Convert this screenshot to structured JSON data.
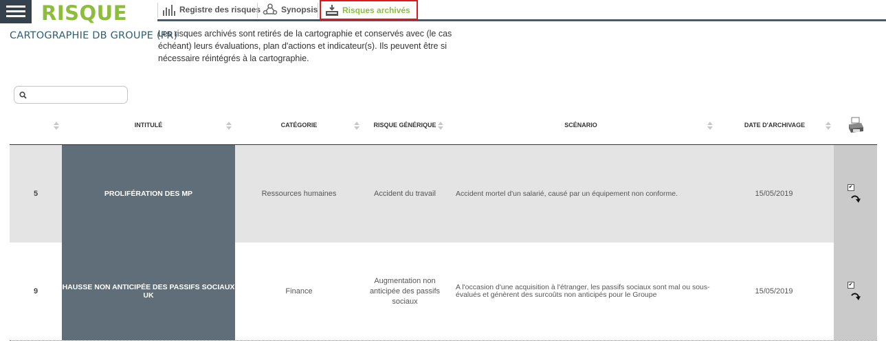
{
  "header": {
    "app_title": "RISQUE",
    "subtitle": "CARTOGRAPHIE DB GROUPE (FR)",
    "menu_icon": "hamburger-icon"
  },
  "tabs": [
    {
      "label": "Registre des risques",
      "icon": "bar-chart-icon",
      "active": false
    },
    {
      "label": "Synopsis",
      "icon": "network-icon",
      "active": false
    },
    {
      "label": "Risques archivés",
      "icon": "archive-icon",
      "active": true
    }
  ],
  "description": "Les risques archivés sont retirés de la cartographie et conservés avec (le cas échéant) leurs évaluations, plan d'actions et indicateur(s). Ils peuvent être si nécessaire réintégrés à la cartographie.",
  "search": {
    "placeholder": "",
    "value": "",
    "icon": "search-icon"
  },
  "table": {
    "columns": [
      "",
      "INTITULÉ",
      "CATÉGORIE",
      "RISQUE GÉNÉRIQUE",
      "SCÉNARIO",
      "DATE D'ARCHIVAGE"
    ],
    "print_icon": "printer-icon",
    "rows": [
      {
        "num": "5",
        "intitule": "PROLIFÉRATION DES MP",
        "categorie": "Ressources humaines",
        "risque_generique": "Accident du travail",
        "scenario": "Accident mortel d'un salarié, causé par un équipement non conforme.",
        "date": "15/05/2019",
        "checked": true
      },
      {
        "num": "9",
        "intitule": "HAUSSE NON ANTICIPÉE DES PASSIFS SOCIAUX UK",
        "categorie": "Finance",
        "risque_generique": "Augmentation non anticipée des passifs sociaux",
        "scenario": "A l'occasion d'une acquisition à l'étranger, les passifs sociaux sont mal ou sous-évalués et génèrent des surcoûts non anticipés pour le Groupe",
        "date": "15/05/2019",
        "checked": true
      }
    ]
  },
  "colors": {
    "brand_green": "#8cbd3b",
    "dark_slate": "#35424d",
    "title_cell": "#5f6e78",
    "highlight_red": "#e0161d"
  }
}
